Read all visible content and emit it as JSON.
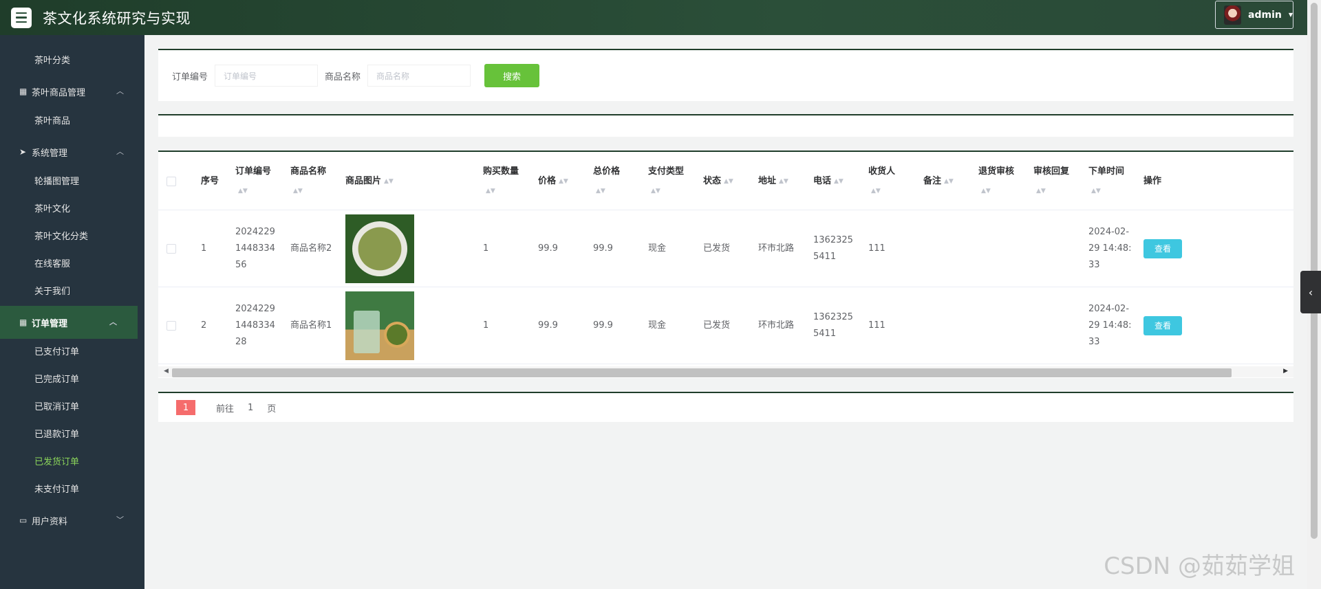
{
  "header": {
    "title": "茶文化系统研究与实现",
    "user": "admin"
  },
  "sidebar": {
    "items": [
      {
        "type": "sub",
        "label": "茶叶分类"
      },
      {
        "type": "group",
        "label": "茶叶商品管理",
        "icon": "grid-icon",
        "arrow": "^"
      },
      {
        "type": "sub",
        "label": "茶叶商品"
      },
      {
        "type": "group",
        "label": "系统管理",
        "icon": "send-icon",
        "arrow": "^"
      },
      {
        "type": "sub",
        "label": "轮播图管理"
      },
      {
        "type": "sub",
        "label": "茶叶文化"
      },
      {
        "type": "sub",
        "label": "茶叶文化分类"
      },
      {
        "type": "sub",
        "label": "在线客服"
      },
      {
        "type": "sub",
        "label": "关于我们"
      },
      {
        "type": "group",
        "label": "订单管理",
        "icon": "grid-icon",
        "arrow": "^",
        "active": true
      },
      {
        "type": "sub",
        "label": "已支付订单"
      },
      {
        "type": "sub",
        "label": "已完成订单"
      },
      {
        "type": "sub",
        "label": "已取消订单"
      },
      {
        "type": "sub",
        "label": "已退款订单"
      },
      {
        "type": "sub",
        "label": "已发货订单",
        "active": true
      },
      {
        "type": "sub",
        "label": "未支付订单"
      },
      {
        "type": "group",
        "label": "用户资料",
        "icon": "calendar-icon",
        "arrow": "v"
      }
    ]
  },
  "search": {
    "order_label": "订单编号",
    "order_placeholder": "订单编号",
    "product_label": "商品名称",
    "product_placeholder": "商品名称",
    "button": "搜索"
  },
  "table": {
    "columns": [
      "序号",
      "订单编号",
      "商品名称",
      "商品图片",
      "购买数量",
      "价格",
      "总价格",
      "支付类型",
      "状态",
      "地址",
      "电话",
      "收货人",
      "备注",
      "退货审核",
      "审核回复",
      "下单时间",
      "操作"
    ],
    "rows": [
      {
        "index": "1",
        "order_no": "20242291448334 56",
        "product": "商品名称2",
        "qty": "1",
        "price": "99.9",
        "total": "99.9",
        "pay": "现金",
        "status": "已发货",
        "address": "环市北路",
        "phone": "13623255411",
        "receiver": "111",
        "remark": "",
        "return_review": "",
        "review_reply": "",
        "time": "2024-02-29 14:48:33",
        "action": "查看"
      },
      {
        "index": "2",
        "order_no": "20242291448334 28",
        "product": "商品名称1",
        "qty": "1",
        "price": "99.9",
        "total": "99.9",
        "pay": "现金",
        "status": "已发货",
        "address": "环市北路",
        "phone": "13623255411",
        "receiver": "111",
        "remark": "",
        "return_review": "",
        "review_reply": "",
        "time": "2024-02-29 14:48:33",
        "action": "查看"
      }
    ]
  },
  "pager": {
    "current": "1",
    "goto_label": "前往",
    "page_value": "1",
    "page_suffix": "页"
  },
  "watermark": "CSDN @茹茹学姐"
}
